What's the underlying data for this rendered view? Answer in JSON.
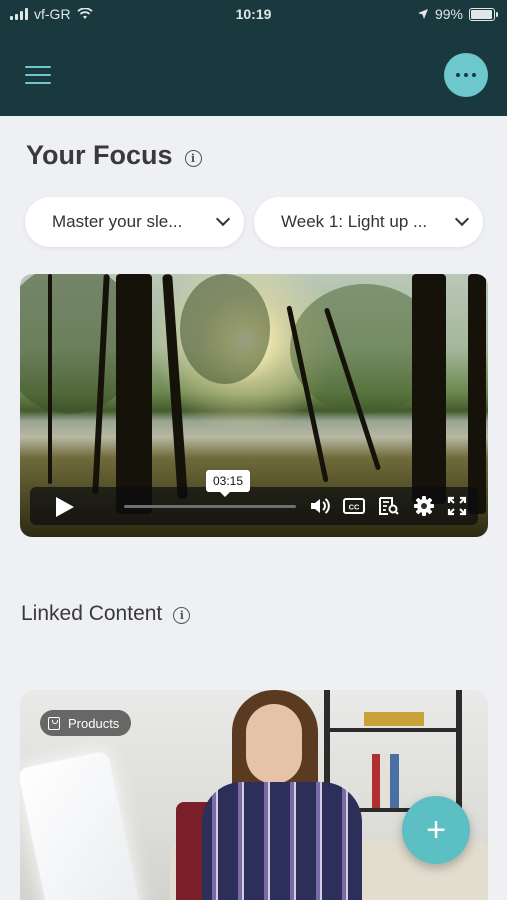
{
  "status_bar": {
    "carrier": "vf-GR",
    "time": "10:19",
    "battery": "99%"
  },
  "header": {
    "menu_icon": "hamburger-icon",
    "more_icon": "more-horizontal-icon"
  },
  "page": {
    "title": "Your Focus"
  },
  "dropdowns": [
    {
      "label": "Master your sle..."
    },
    {
      "label": "Week 1: Light up ..."
    }
  ],
  "video": {
    "tooltip_time": "03:15",
    "controls": [
      "play-icon",
      "volume-icon",
      "closed-captions-icon",
      "transcript-icon",
      "settings-icon",
      "fullscreen-icon"
    ]
  },
  "linked_content": {
    "title": "Linked Content",
    "card_badge": "Products"
  },
  "fab": {
    "label": "+"
  },
  "colors": {
    "header_bg": "#19393f",
    "accent": "#6cc8cd",
    "fab": "#5cbfc3",
    "page_bg": "#eef0f3"
  }
}
